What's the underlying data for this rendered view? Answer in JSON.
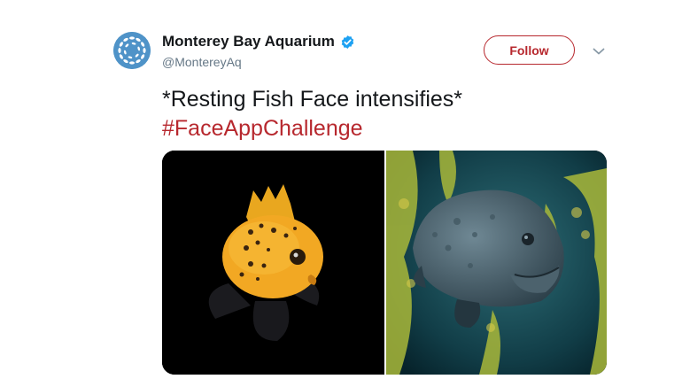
{
  "tweet": {
    "author": {
      "display_name": "Monterey Bay Aquarium",
      "handle": "@MontereyAq",
      "verified": true,
      "verified_icon": "verified-badge-icon",
      "avatar_icon": "aquarium-logo-icon"
    },
    "follow_label": "Follow",
    "menu_icon": "chevron-down-icon",
    "text": "*Resting Fish Face intensifies*",
    "hashtag": "#FaceAppChallenge",
    "media": [
      {
        "subject": "orange spotted fish on black background"
      },
      {
        "subject": "giant sea bass among kelp"
      }
    ]
  },
  "colors": {
    "accent": "#b7282e",
    "verified": "#1da1f2",
    "handle": "#657786",
    "text": "#14171a"
  }
}
